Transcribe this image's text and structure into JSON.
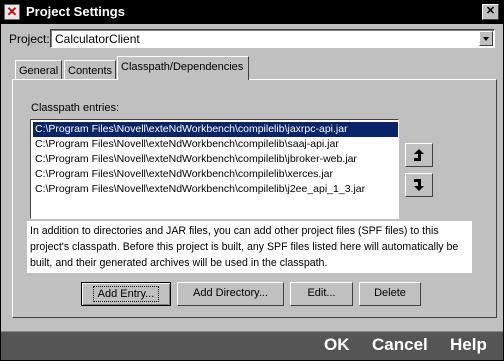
{
  "window": {
    "title": "Project Settings"
  },
  "project": {
    "label": "Project:",
    "value": "CalculatorClient"
  },
  "tabs": [
    {
      "label": "General"
    },
    {
      "label": "Contents"
    },
    {
      "label": "Classpath/Dependencies"
    }
  ],
  "classpath": {
    "label": "Classpath entries:",
    "entries": [
      "C:\\Program Files\\Novell\\exteNdWorkbench\\compilelib\\jaxrpc-api.jar",
      "C:\\Program Files\\Novell\\exteNdWorkbench\\compilelib\\saaj-api.jar",
      "C:\\Program Files\\Novell\\exteNdWorkbench\\compilelib\\jbroker-web.jar",
      "C:\\Program Files\\Novell\\exteNdWorkbench\\compilelib\\xerces.jar",
      "C:\\Program Files\\Novell\\exteNdWorkbench\\compilelib\\j2ee_api_1_3.jar"
    ],
    "selected_index": 0
  },
  "description": {
    "lines": [
      "In addition to directories and JAR files, you can add other project files (SPF files) to this",
      "project's classpath. Before this project is built, any SPF files listed here will automatically be",
      "built, and their generated archives will be used in the classpath."
    ]
  },
  "buttons": {
    "add_entry": "Add Entry...",
    "add_directory": "Add Directory...",
    "edit": "Edit...",
    "delete": "Delete"
  },
  "footer": {
    "ok": "OK",
    "cancel": "Cancel",
    "help": "Help"
  },
  "colors": {
    "selection": "#0a246a",
    "title_bar": "#000000",
    "dialog_bg": "#c0c0c0",
    "footer_bg": "#555555"
  },
  "icons": {
    "move_up": "up-arrow-icon",
    "move_down": "down-arrow-icon",
    "close": "close-icon",
    "app": "app-icon"
  }
}
